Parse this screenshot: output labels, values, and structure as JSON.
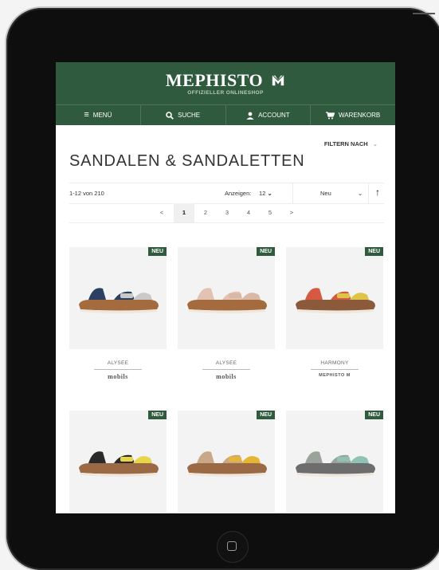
{
  "header": {
    "logo": "MEPHISTO",
    "tagline": "OFFIZIELLER ONLINESHOP",
    "brand_color": "#2f5a3d"
  },
  "nav": {
    "menu": "MENÜ",
    "search": "SUCHE",
    "account": "ACCOUNT",
    "cart": "WARENKORB"
  },
  "filter": {
    "label": "FILTERN NACH"
  },
  "page_title": "SANDALEN & SANDALETTEN",
  "toolbar": {
    "count": "1-12 von 210",
    "show_label": "Anzeigen:",
    "show_value": "12",
    "sort_value": "Neu"
  },
  "pagination": {
    "prev": "<",
    "pages": [
      "1",
      "2",
      "3",
      "4",
      "5"
    ],
    "next": ">",
    "current": "1"
  },
  "products": [
    {
      "badge": "NEU",
      "name": "ALYSEE",
      "brand": "mobils",
      "colors": [
        "#2d3f63",
        "#a36b3e",
        "#c9c9c9"
      ]
    },
    {
      "badge": "NEU",
      "name": "ALYSEE",
      "brand": "mobils",
      "colors": [
        "#e2c2b2",
        "#a36b3e",
        "#d9b8a6"
      ]
    },
    {
      "badge": "NEU",
      "name": "HARMONY",
      "brand": "MEPHISTO",
      "colors": [
        "#d65a43",
        "#8a5a3a",
        "#e0c447"
      ]
    },
    {
      "badge": "NEU",
      "name": "",
      "brand": "",
      "colors": [
        "#2a2a2a",
        "#9b6a44",
        "#e8d64a"
      ]
    },
    {
      "badge": "NEU",
      "name": "",
      "brand": "",
      "colors": [
        "#c9a888",
        "#9b6a44",
        "#e5b534"
      ]
    },
    {
      "badge": "NEU",
      "name": "",
      "brand": "",
      "colors": [
        "#9aa39a",
        "#6d6d6d",
        "#8fc2b5"
      ]
    }
  ]
}
